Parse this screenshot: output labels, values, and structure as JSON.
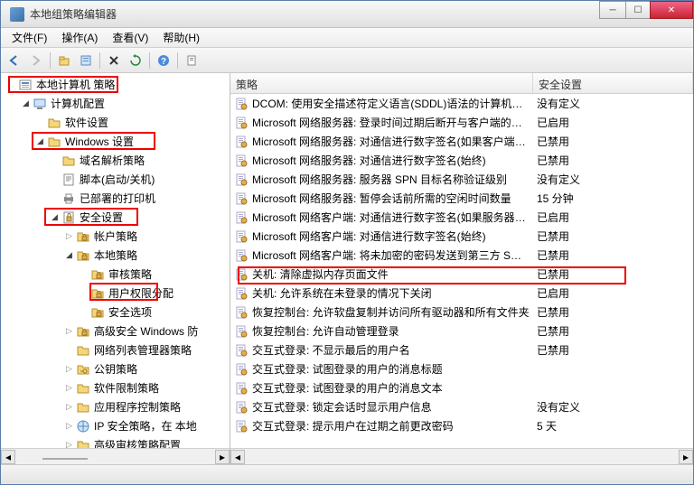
{
  "title": "本地组策略编辑器",
  "menu": [
    "文件(F)",
    "操作(A)",
    "查看(V)",
    "帮助(H)"
  ],
  "toolbar_icons": [
    "back-icon",
    "forward-icon",
    "up-icon",
    "show-icon",
    "delete-icon",
    "refresh-icon",
    "help-icon",
    "export-icon"
  ],
  "tree": [
    {
      "indent": 0,
      "exp": "",
      "icon": "root",
      "label": "本地计算机 策略"
    },
    {
      "indent": 1,
      "exp": "▾",
      "icon": "computer",
      "label": "计算机配置"
    },
    {
      "indent": 2,
      "exp": "",
      "icon": "folder",
      "label": "软件设置"
    },
    {
      "indent": 2,
      "exp": "▾",
      "icon": "folder",
      "label": "Windows 设置"
    },
    {
      "indent": 3,
      "exp": "",
      "icon": "folder",
      "label": "域名解析策略"
    },
    {
      "indent": 3,
      "exp": "",
      "icon": "script",
      "label": "脚本(启动/关机)"
    },
    {
      "indent": 3,
      "exp": "",
      "icon": "printer",
      "label": "已部署的打印机"
    },
    {
      "indent": 3,
      "exp": "▾",
      "icon": "security",
      "label": "安全设置"
    },
    {
      "indent": 4,
      "exp": "▸",
      "icon": "policy-folder",
      "label": "帐户策略"
    },
    {
      "indent": 4,
      "exp": "▾",
      "icon": "policy-folder",
      "label": "本地策略"
    },
    {
      "indent": 5,
      "exp": "",
      "icon": "policy-folder",
      "label": "审核策略"
    },
    {
      "indent": 5,
      "exp": "",
      "icon": "policy-folder",
      "label": "用户权限分配"
    },
    {
      "indent": 5,
      "exp": "",
      "icon": "policy-folder",
      "label": "安全选项"
    },
    {
      "indent": 4,
      "exp": "▸",
      "icon": "policy-folder",
      "label": "高级安全 Windows 防"
    },
    {
      "indent": 4,
      "exp": "",
      "icon": "folder",
      "label": "网络列表管理器策略"
    },
    {
      "indent": 4,
      "exp": "▸",
      "icon": "folder-key",
      "label": "公钥策略"
    },
    {
      "indent": 4,
      "exp": "▸",
      "icon": "folder",
      "label": "软件限制策略"
    },
    {
      "indent": 4,
      "exp": "▸",
      "icon": "folder",
      "label": "应用程序控制策略"
    },
    {
      "indent": 4,
      "exp": "▸",
      "icon": "ipsec",
      "label": "IP 安全策略，在 本地"
    },
    {
      "indent": 4,
      "exp": "▸",
      "icon": "folder",
      "label": "高级审核策略配置"
    }
  ],
  "columns": [
    "策略",
    "安全设置"
  ],
  "rows": [
    {
      "p": "DCOM: 使用安全描述符定义语言(SDDL)语法的计算机启动...",
      "v": "没有定义"
    },
    {
      "p": "Microsoft 网络服务器: 登录时间过期后断开与客户端的连接",
      "v": "已启用"
    },
    {
      "p": "Microsoft 网络服务器: 对通信进行数字签名(如果客户端允...",
      "v": "已禁用"
    },
    {
      "p": "Microsoft 网络服务器: 对通信进行数字签名(始终)",
      "v": "已禁用"
    },
    {
      "p": "Microsoft 网络服务器: 服务器 SPN 目标名称验证级别",
      "v": "没有定义"
    },
    {
      "p": "Microsoft 网络服务器: 暂停会话前所需的空闲时间数量",
      "v": "15 分钟"
    },
    {
      "p": "Microsoft 网络客户端: 对通信进行数字签名(如果服务器允...",
      "v": "已启用"
    },
    {
      "p": "Microsoft 网络客户端: 对通信进行数字签名(始终)",
      "v": "已禁用"
    },
    {
      "p": "Microsoft 网络客户端: 将未加密的密码发送到第三方 SMB...",
      "v": "已禁用"
    },
    {
      "p": "关机: 清除虚拟内存页面文件",
      "v": "已禁用"
    },
    {
      "p": "关机: 允许系统在未登录的情况下关闭",
      "v": "已启用"
    },
    {
      "p": "恢复控制台: 允许软盘复制并访问所有驱动器和所有文件夹",
      "v": "已禁用"
    },
    {
      "p": "恢复控制台: 允许自动管理登录",
      "v": "已禁用"
    },
    {
      "p": "交互式登录: 不显示最后的用户名",
      "v": "已禁用"
    },
    {
      "p": "交互式登录: 试图登录的用户的消息标题",
      "v": ""
    },
    {
      "p": "交互式登录: 试图登录的用户的消息文本",
      "v": ""
    },
    {
      "p": "交互式登录: 锁定会话时显示用户信息",
      "v": "没有定义"
    },
    {
      "p": "交互式登录: 提示用户在过期之前更改密码",
      "v": "5 天"
    }
  ]
}
